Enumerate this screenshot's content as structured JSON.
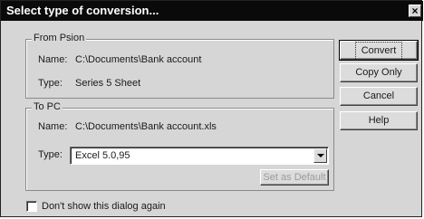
{
  "window": {
    "title": "Select type of conversion...",
    "close_glyph": "×"
  },
  "from_group": {
    "label": "From Psion",
    "name_label": "Name:",
    "name_value": "C:\\Documents\\Bank account",
    "type_label": "Type:",
    "type_value": "Series 5 Sheet"
  },
  "to_group": {
    "label": "To PC",
    "name_label": "Name:",
    "name_value": "C:\\Documents\\Bank account.xls",
    "type_label": "Type:",
    "type_selected": "Excel 5.0,95",
    "set_default_label": "Set as Default"
  },
  "buttons": {
    "convert": "Convert",
    "copy_only": "Copy Only",
    "cancel": "Cancel",
    "help": "Help"
  },
  "checkbox": {
    "label": "Don't show this dialog again",
    "checked": false
  }
}
